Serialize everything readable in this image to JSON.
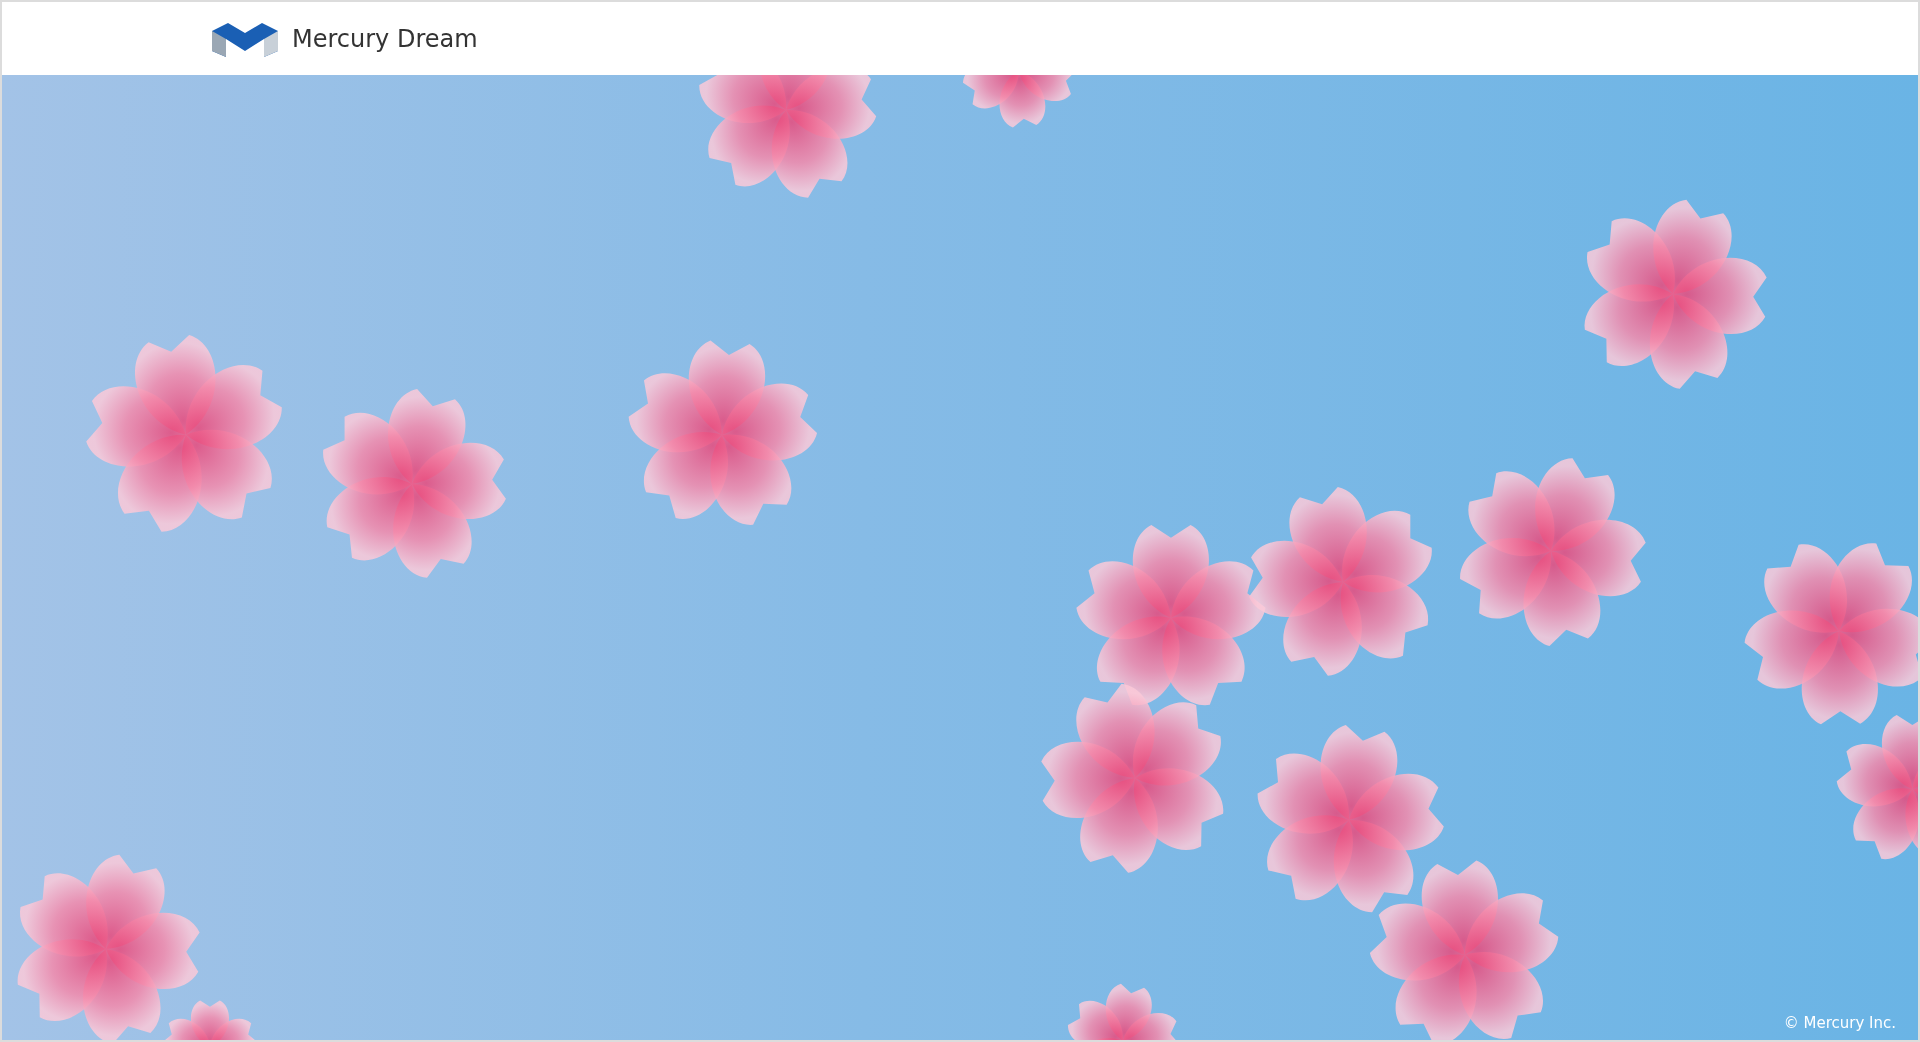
{
  "header": {
    "brand": "Mercury Dream"
  },
  "footer": {
    "copyright": "© Mercury Inc."
  }
}
